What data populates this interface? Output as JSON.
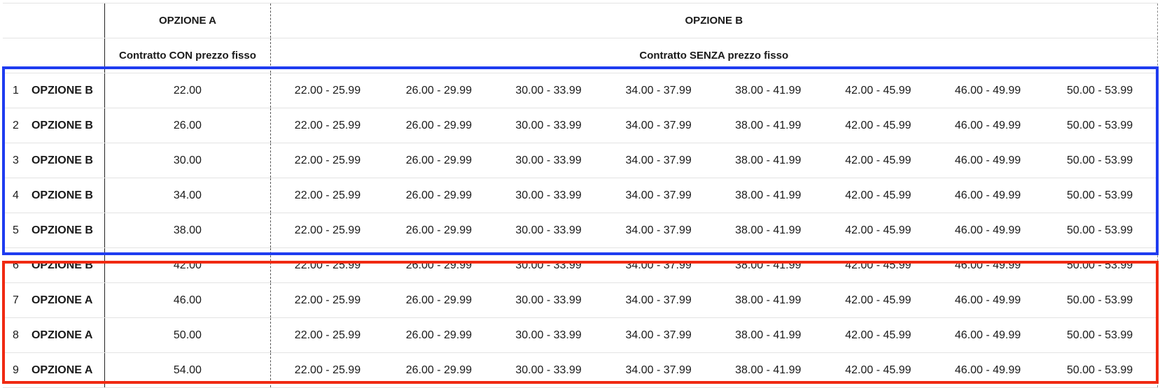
{
  "header": {
    "group_a_title": "OPZIONE A",
    "group_b_title": "OPZIONE B",
    "group_a_subtitle": "Contratto CON prezzo fisso",
    "group_b_subtitle": "Contratto SENZA prezzo fisso"
  },
  "ranges": [
    "22.00 - 25.99",
    "26.00 - 29.99",
    "30.00 - 33.99",
    "34.00 - 37.99",
    "38.00 - 41.99",
    "42.00 - 45.99",
    "46.00 - 49.99",
    "50.00 - 53.99"
  ],
  "rows": [
    {
      "num": "1",
      "label": "OPZIONE B",
      "fixed": "22.00"
    },
    {
      "num": "2",
      "label": "OPZIONE B",
      "fixed": "26.00"
    },
    {
      "num": "3",
      "label": "OPZIONE B",
      "fixed": "30.00"
    },
    {
      "num": "4",
      "label": "OPZIONE B",
      "fixed": "34.00"
    },
    {
      "num": "5",
      "label": "OPZIONE B",
      "fixed": "38.00"
    },
    {
      "num": "6",
      "label": "OPZIONE B",
      "fixed": "42.00"
    },
    {
      "num": "7",
      "label": "OPZIONE A",
      "fixed": "46.00"
    },
    {
      "num": "8",
      "label": "OPZIONE A",
      "fixed": "50.00"
    },
    {
      "num": "9",
      "label": "OPZIONE A",
      "fixed": "54.00"
    }
  ],
  "highlight": {
    "option_b_color": "#1f3cf0",
    "option_a_color": "#f02a12"
  }
}
